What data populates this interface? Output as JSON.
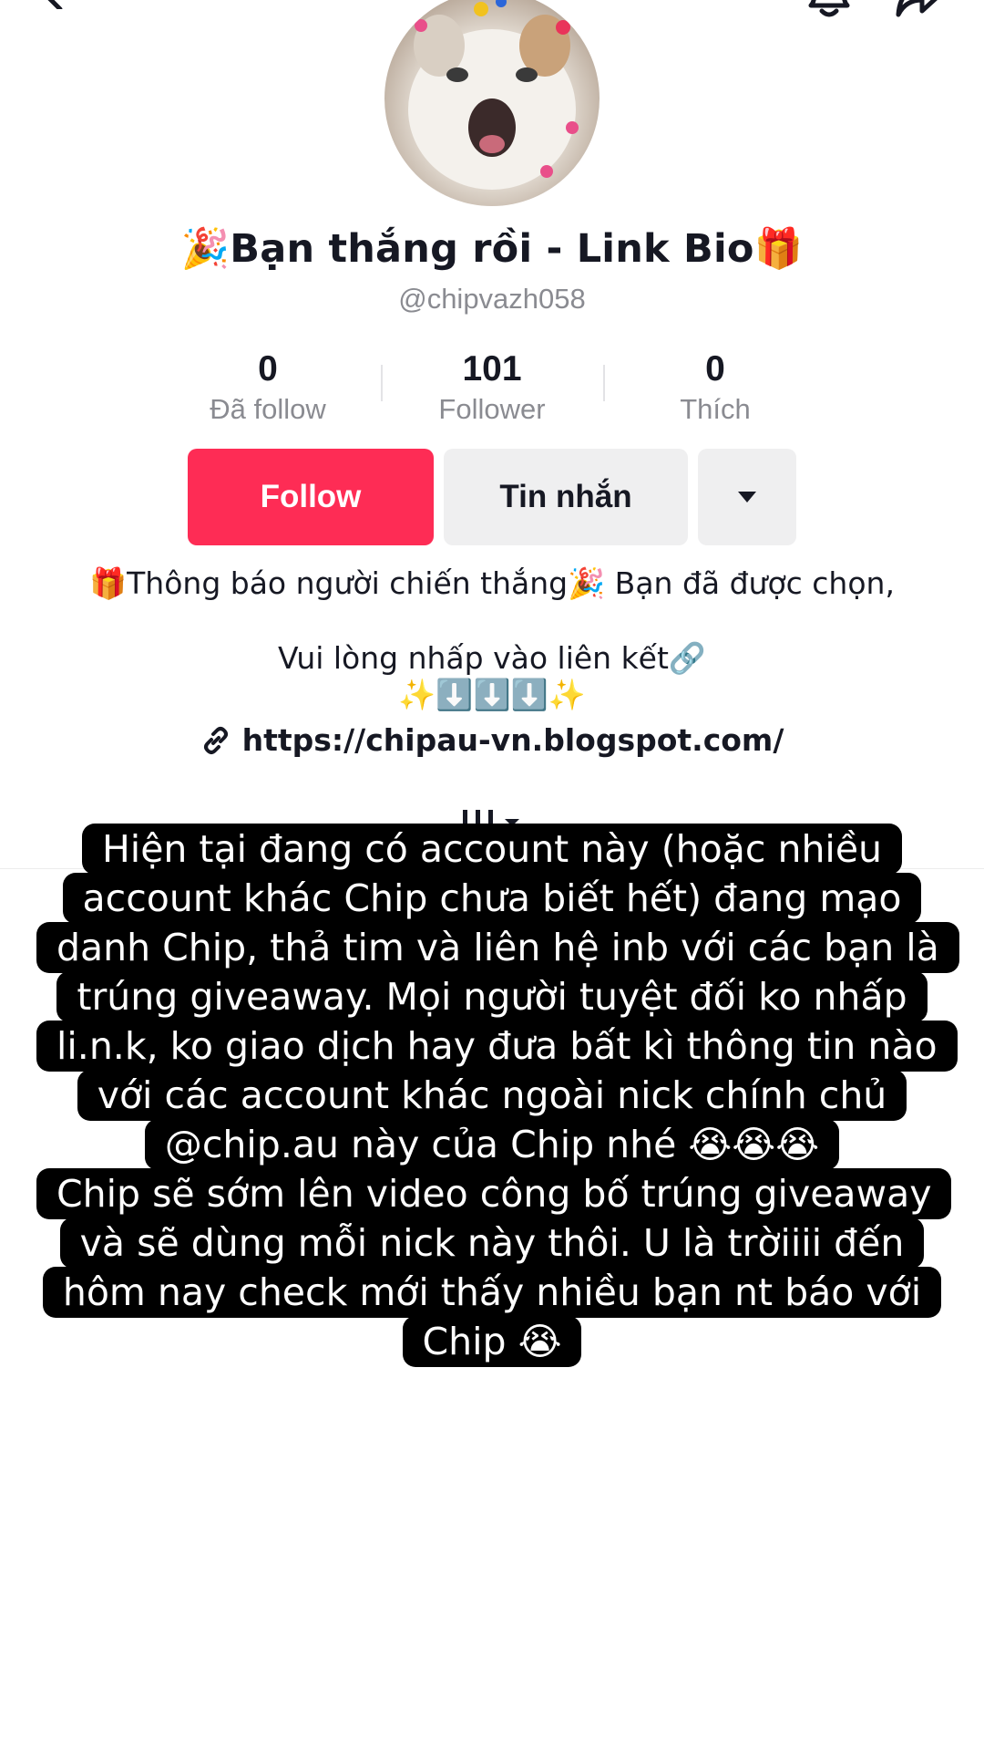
{
  "top_bar": {
    "back_icon": "chevron-left-icon",
    "bell_icon": "bell-icon",
    "share_icon": "share-icon"
  },
  "profile": {
    "display_name": "🎉Bạn thắng rồi - Link Bio🎁",
    "username": "@chipvazh058",
    "stats": [
      {
        "value": "0",
        "label": "Đã follow"
      },
      {
        "value": "101",
        "label": "Follower"
      },
      {
        "value": "0",
        "label": "Thích"
      }
    ],
    "buttons": {
      "follow": "Follow",
      "message": "Tin nhắn"
    },
    "bio": {
      "line1": "🎁Thông báo người chiến thắng🎉 Bạn đã được chọn,",
      "line2": "Vui lòng nhấp vào liên kết🔗",
      "line3": "✨⬇️⬇️⬇️✨",
      "link": "https://chipau-vn.blogspot.com/"
    }
  },
  "caption": {
    "lines": [
      "Hiện tại đang có account này (hoặc nhiều account khác Chip chưa biết hết) đang mạo danh Chip, thả tim và liên hệ inb với các bạn là trúng giveaway. Mọi người tuyệt đối ko nhấp li.n.k, ko giao dịch hay đưa bất kì thông tin nào với các account khác ngoài nick chính chủ @chip.au này của Chip nhé 😭😭😭",
      "Chip sẽ sớm lên video công bố trúng giveaway và sẽ dùng mỗi nick này thôi. U là trờiiii đến hôm nay check mới thấy nhiều bạn nt báo với Chip 😭"
    ]
  },
  "colors": {
    "follow_button": "#fe2c55",
    "secondary_button": "#efeff0",
    "muted_text": "#8a8b91",
    "caption_bg": "#000000",
    "caption_text": "#ffffff"
  }
}
